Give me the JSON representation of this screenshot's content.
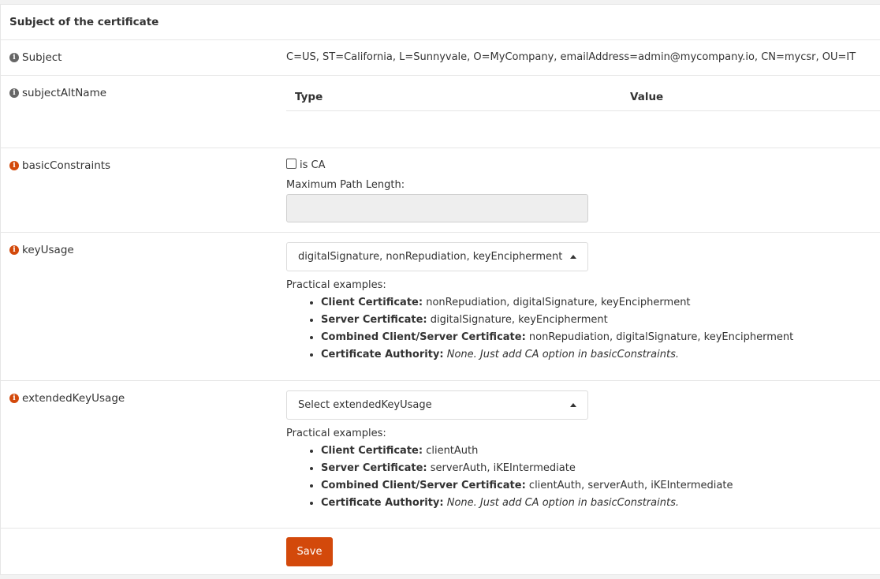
{
  "section": {
    "title": "Subject of the certificate"
  },
  "subject": {
    "label": "Subject",
    "value": "C=US, ST=California, L=Sunnyvale, O=MyCompany, emailAddress=admin@mycompany.io, CN=mycsr, OU=IT"
  },
  "subject_alt_name": {
    "label": "subjectAltName",
    "columns": [
      "Type",
      "Value"
    ]
  },
  "basic_constraints": {
    "label": "basicConstraints",
    "checkbox_label": "is CA",
    "checked": false,
    "max_path_label": "Maximum Path Length:",
    "max_path_value": ""
  },
  "key_usage": {
    "label": "keyUsage",
    "selected": "digitalSignature, nonRepudiation, keyEncipherment",
    "examples_title": "Practical examples:",
    "examples": [
      {
        "name": "Client Certificate:",
        "value": "nonRepudiation, digitalSignature, keyEncipherment",
        "italic": false
      },
      {
        "name": "Server Certificate:",
        "value": "digitalSignature, keyEncipherment",
        "italic": false
      },
      {
        "name": "Combined Client/Server Certificate:",
        "value": "nonRepudiation, digitalSignature, keyEncipherment",
        "italic": false
      },
      {
        "name": "Certificate Authority:",
        "value": "None. Just add CA option in basicConstraints.",
        "italic": true
      }
    ]
  },
  "extended_key_usage": {
    "label": "extendedKeyUsage",
    "placeholder": "Select extendedKeyUsage",
    "examples_title": "Practical examples:",
    "examples": [
      {
        "name": "Client Certificate:",
        "value": "clientAuth",
        "italic": false
      },
      {
        "name": "Server Certificate:",
        "value": "serverAuth, iKEIntermediate",
        "italic": false
      },
      {
        "name": "Combined Client/Server Certificate:",
        "value": "clientAuth, serverAuth, iKEIntermediate",
        "italic": false
      },
      {
        "name": "Certificate Authority:",
        "value": "None. Just add CA option in basicConstraints.",
        "italic": true
      }
    ]
  },
  "actions": {
    "save_label": "Save"
  },
  "icons": {
    "info_glyph": "i"
  },
  "colors": {
    "accent": "#d3490b",
    "info_gray": "#666666",
    "info_orange": "#d3490b"
  }
}
